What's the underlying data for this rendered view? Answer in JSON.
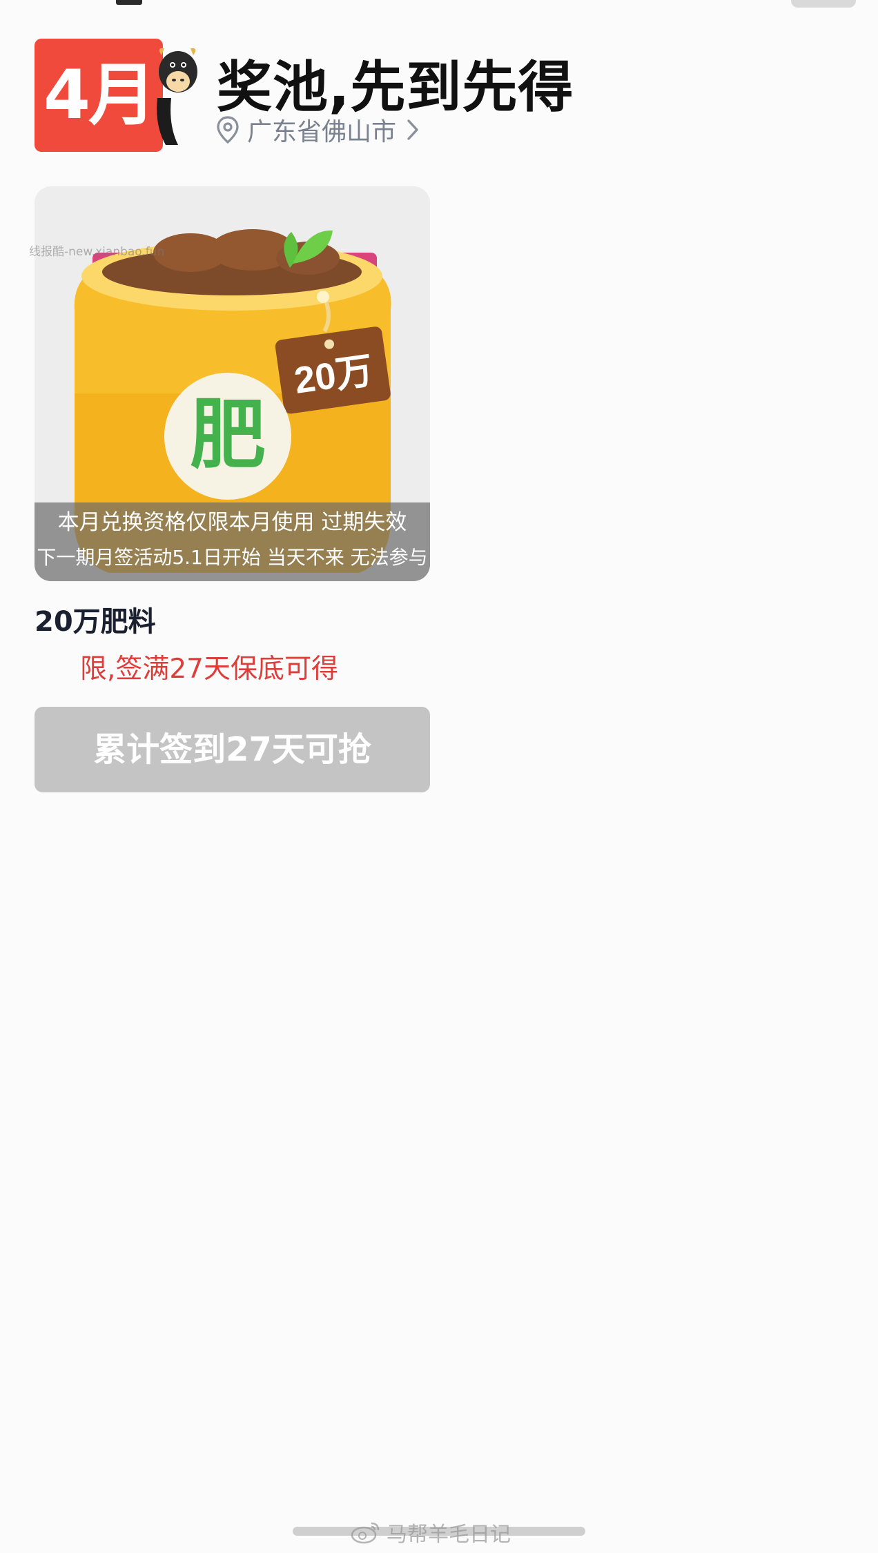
{
  "header": {
    "month_badge": "4月",
    "title": "奖池,先到先得",
    "location": "广东省佛山市"
  },
  "prize": {
    "image_tag": "20万",
    "image_bag_label": "肥",
    "notice_line1": "本月兑换资格仅限本月使用 过期失效",
    "notice_line2": "下一期月签活动5.1日开始 当天不来 无法参与",
    "name": "20万肥料",
    "description": "限,签满27天保底可得",
    "button_label": "累计签到27天可抢"
  },
  "watermarks": {
    "top": "线报酷-new.xianbao.fun",
    "bottom": "马帮羊毛日记"
  },
  "colors": {
    "badge": "#ef4a3c",
    "accent_red": "#de3e3a",
    "button_disabled": "#c4c4c4",
    "bag_yellow": "#f8bd2a",
    "bag_label_green": "#43b14c"
  },
  "icons": [
    "location-pin-icon",
    "chevron-right-icon",
    "mascot-icon",
    "weibo-icon"
  ]
}
